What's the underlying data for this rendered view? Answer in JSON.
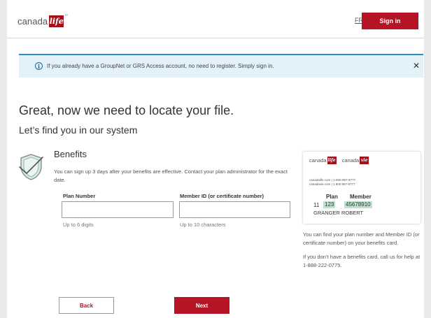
{
  "header": {
    "logo_text": "canada",
    "logo_mark": "life",
    "logo_tm": "™",
    "lang_link": "FR",
    "signin_label": "Sign in"
  },
  "banner": {
    "icon": "info-icon",
    "icon_glyph": "i",
    "text": "If you already have a GroupNet or GRS Access account, no need to register. Simply sign in.",
    "close_glyph": "✕"
  },
  "main": {
    "title": "Great, now we need to locate your file.",
    "subtitle": "Let’s find you in our system"
  },
  "benefits": {
    "icon": "shield-check-icon",
    "title": "Benefits",
    "description": "You can sign up 3 days after your benefits are effective. Contact your plan administrator for the exact date.",
    "plan_number": {
      "label": "Plan Number",
      "value": "",
      "hint": "Up to 6 digits"
    },
    "member_id": {
      "label": "Member ID (or certificate number)",
      "value": "",
      "hint": "Up to 10 characters"
    }
  },
  "card": {
    "brand1_text": "canada",
    "brand1_mark": "life",
    "brand2_text": "canada",
    "brand2_mark": "vie",
    "line1": "canadalife.com | 1-800-957-9777",
    "line2": "canadavie.com | 1 800 957-9777",
    "plan_header": "Plan",
    "member_header": "Member",
    "prefix": "11",
    "plan_value": "123",
    "member_value": "45678910",
    "name": "GRANGER ROBERT"
  },
  "side": {
    "help1": "You can find your plan number and Member ID (or certificate number) on your benefits card.",
    "help2": "If you don’t have a benefits card, call us for help at 1-888-222-0775."
  },
  "actions": {
    "back_label": "Back",
    "next_label": "Next"
  },
  "colors": {
    "brand_red": "#b51424",
    "banner_bg": "#e3f1f9",
    "banner_accent": "#2a8fc7",
    "card_highlight": "#bfe1cf"
  }
}
